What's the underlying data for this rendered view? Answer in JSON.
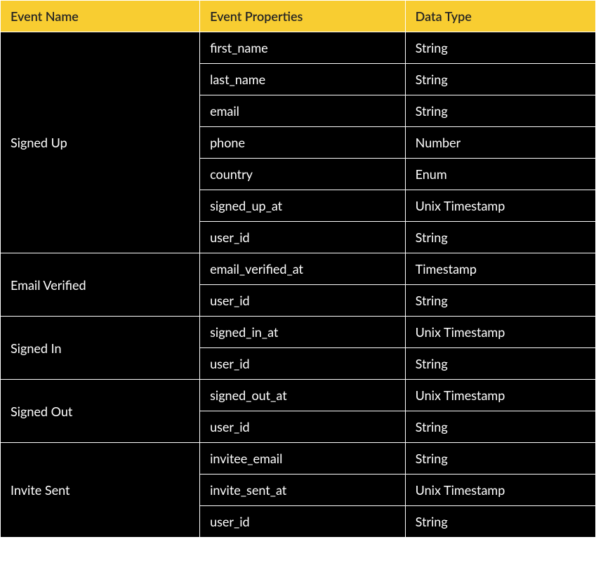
{
  "headers": {
    "event_name": "Event Name",
    "event_properties": "Event Properties",
    "data_type": "Data Type"
  },
  "events": [
    {
      "name": "Signed Up",
      "properties": [
        {
          "name": "first_name",
          "type": "String"
        },
        {
          "name": "last_name",
          "type": "String"
        },
        {
          "name": "email",
          "type": "String"
        },
        {
          "name": "phone",
          "type": "Number"
        },
        {
          "name": "country",
          "type": "Enum"
        },
        {
          "name": "signed_up_at",
          "type": "Unix Timestamp"
        },
        {
          "name": "user_id",
          "type": "String"
        }
      ]
    },
    {
      "name": "Email Verified",
      "properties": [
        {
          "name": "email_verified_at",
          "type": "Timestamp"
        },
        {
          "name": "user_id",
          "type": "String"
        }
      ]
    },
    {
      "name": "Signed In",
      "properties": [
        {
          "name": "signed_in_at",
          "type": "Unix Timestamp"
        },
        {
          "name": "user_id",
          "type": "String"
        }
      ]
    },
    {
      "name": "Signed Out",
      "properties": [
        {
          "name": "signed_out_at",
          "type": "Unix Timestamp"
        },
        {
          "name": "user_id",
          "type": "String"
        }
      ]
    },
    {
      "name": "Invite Sent",
      "properties": [
        {
          "name": "invitee_email",
          "type": "String"
        },
        {
          "name": "invite_sent_at",
          "type": "Unix Timestamp"
        },
        {
          "name": "user_id",
          "type": "String"
        }
      ]
    }
  ]
}
